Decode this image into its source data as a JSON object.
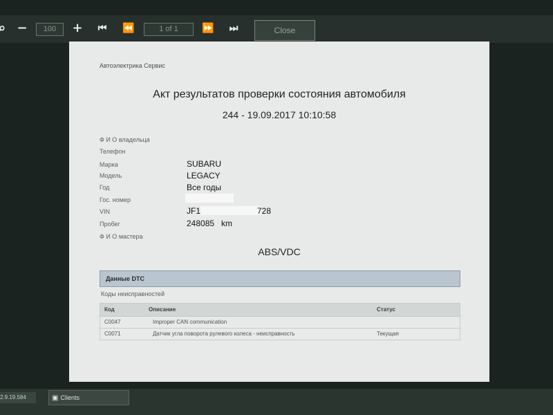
{
  "toolbar": {
    "zoom_value": "100",
    "page_indicator": "1 of 1",
    "close_label": "Close",
    "icons": [
      "zoom-out-icon",
      "zoom-in-icon",
      "first-page-icon",
      "previous-page-icon",
      "next-page-icon",
      "last-page-icon"
    ]
  },
  "report": {
    "company": "Автоэлектрика Сервис",
    "title": "Акт результатов проверки состояния автомобиля",
    "subtitle": "244 - 19.09.2017 10:10:58",
    "fields": {
      "owner_label": "Ф И О владельца",
      "phone_label": "Телефон",
      "make_label": "Марка",
      "make_value": "SUBARU",
      "model_label": "Модель",
      "model_value": "LEGACY",
      "year_label": "Год",
      "year_value": "Все годы",
      "plate_label": "Гос. номер",
      "vin_label": "VIN",
      "vin_value": "JF1",
      "vin_value_end": "728",
      "mileage_label": "Пробег",
      "mileage_value": "248085   km",
      "master_label": "Ф И О мастера"
    },
    "system_title": "ABS/VDC",
    "dtc_header": "Данные DTC",
    "faults_label": "Коды неисправностей",
    "table": {
      "columns": [
        "Код",
        "Описание",
        "Статус"
      ],
      "rows": [
        {
          "code": "C0047",
          "description": "Improper CAN communication",
          "status": ""
        },
        {
          "code": "C0071",
          "description": "Датчик угла поворота рулевого колеса - неисправность",
          "status": "Текущая"
        }
      ]
    }
  },
  "taskbar": {
    "version": "2.9.19.584",
    "clients_label": "Clients"
  }
}
